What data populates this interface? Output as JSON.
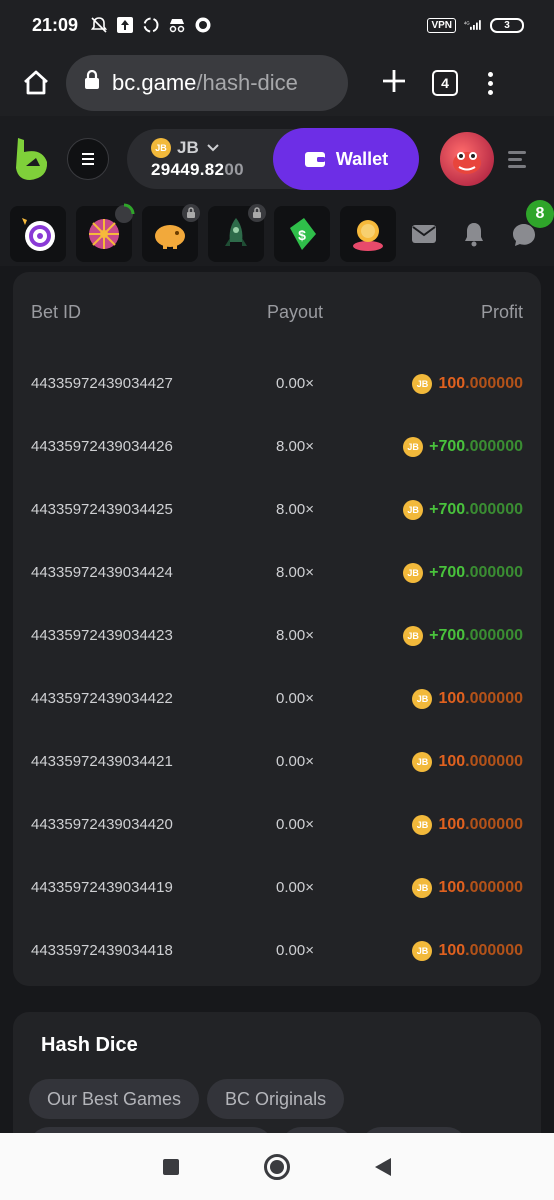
{
  "status_bar": {
    "time": "21:09",
    "vpn": "VPN",
    "network": "4G",
    "battery": "3"
  },
  "browser": {
    "url_domain": "bc.game",
    "url_path": "/hash-dice",
    "tab_count": "4"
  },
  "header": {
    "currency": "JB",
    "balance_main": "29449.82",
    "balance_dim": "00",
    "wallet_label": "Wallet"
  },
  "quick_bar": {
    "notification_count": "8"
  },
  "bets": {
    "columns": {
      "bet_id": "Bet ID",
      "payout": "Payout",
      "profit": "Profit"
    },
    "rows": [
      {
        "id": "44335972439034427",
        "payout": "0.00×",
        "profit_main": "100",
        "profit_dec": ".000000",
        "win": false
      },
      {
        "id": "44335972439034426",
        "payout": "8.00×",
        "profit_main": "+700",
        "profit_dec": ".000000",
        "win": true
      },
      {
        "id": "44335972439034425",
        "payout": "8.00×",
        "profit_main": "+700",
        "profit_dec": ".000000",
        "win": true
      },
      {
        "id": "44335972439034424",
        "payout": "8.00×",
        "profit_main": "+700",
        "profit_dec": ".000000",
        "win": true
      },
      {
        "id": "44335972439034423",
        "payout": "8.00×",
        "profit_main": "+700",
        "profit_dec": ".000000",
        "win": true
      },
      {
        "id": "44335972439034422",
        "payout": "0.00×",
        "profit_main": "100",
        "profit_dec": ".000000",
        "win": false
      },
      {
        "id": "44335972439034421",
        "payout": "0.00×",
        "profit_main": "100",
        "profit_dec": ".000000",
        "win": false
      },
      {
        "id": "44335972439034420",
        "payout": "0.00×",
        "profit_main": "100",
        "profit_dec": ".000000",
        "win": false
      },
      {
        "id": "44335972439034419",
        "payout": "0.00×",
        "profit_main": "100",
        "profit_dec": ".000000",
        "win": false
      },
      {
        "id": "44335972439034418",
        "payout": "0.00×",
        "profit_main": "100",
        "profit_dec": ".000000",
        "win": false
      }
    ]
  },
  "hash_panel": {
    "title": "Hash Dice",
    "tags": [
      "Our Best Games",
      "BC Originals"
    ]
  },
  "icons": {
    "coin": "JB",
    "brand_color": "#6d2ee6",
    "win_color": "#49c23c",
    "loss_color": "#e0611f"
  }
}
